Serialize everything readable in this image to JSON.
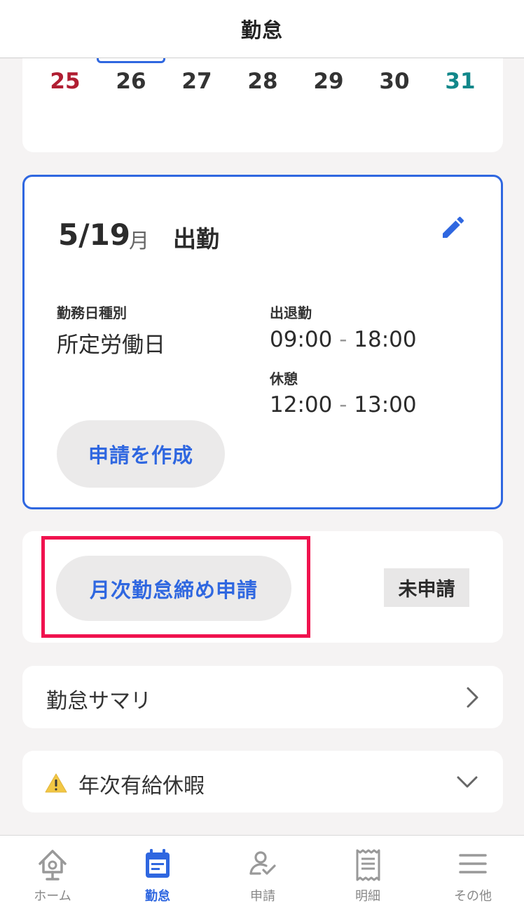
{
  "header": {
    "title": "勤怠"
  },
  "calendar": {
    "days": [
      {
        "label": "25",
        "color": "#b01e32"
      },
      {
        "label": "26",
        "color": "#333333"
      },
      {
        "label": "27",
        "color": "#333333"
      },
      {
        "label": "28",
        "color": "#333333"
      },
      {
        "label": "29",
        "color": "#333333"
      },
      {
        "label": "30",
        "color": "#333333"
      },
      {
        "label": "31",
        "color": "#12878a"
      }
    ]
  },
  "day_card": {
    "date": "5/19",
    "weekday": "月",
    "status": "出勤",
    "edit_icon": "pencil-icon",
    "work_type_label": "勤務日種別",
    "work_type_value": "所定労働日",
    "attendance_label": "出退勤",
    "attendance_start": "09:00",
    "attendance_end": "18:00",
    "break_label": "休憩",
    "break_start": "12:00",
    "break_end": "13:00",
    "separator": "-",
    "create_request_label": "申請を作成"
  },
  "monthly_closing": {
    "button_label": "月次勤怠締め申請",
    "status": "未申請",
    "highlight_color": "#f0124e"
  },
  "summary_row": {
    "label": "勤怠サマリ",
    "icon": "chevron-right-icon"
  },
  "leave_row": {
    "label": "年次有給休暇",
    "warning_icon": "warning-icon",
    "icon": "chevron-down-icon"
  },
  "tabbar": {
    "tabs": [
      {
        "label": "ホーム",
        "icon": "home-icon",
        "active": false
      },
      {
        "label": "勤怠",
        "icon": "calendar-icon",
        "active": true
      },
      {
        "label": "申請",
        "icon": "person-check-icon",
        "active": false
      },
      {
        "label": "明細",
        "icon": "receipt-icon",
        "active": false
      },
      {
        "label": "その他",
        "icon": "menu-icon",
        "active": false
      }
    ]
  },
  "colors": {
    "accent": "#2f67e0",
    "background": "#f5f3f3"
  }
}
